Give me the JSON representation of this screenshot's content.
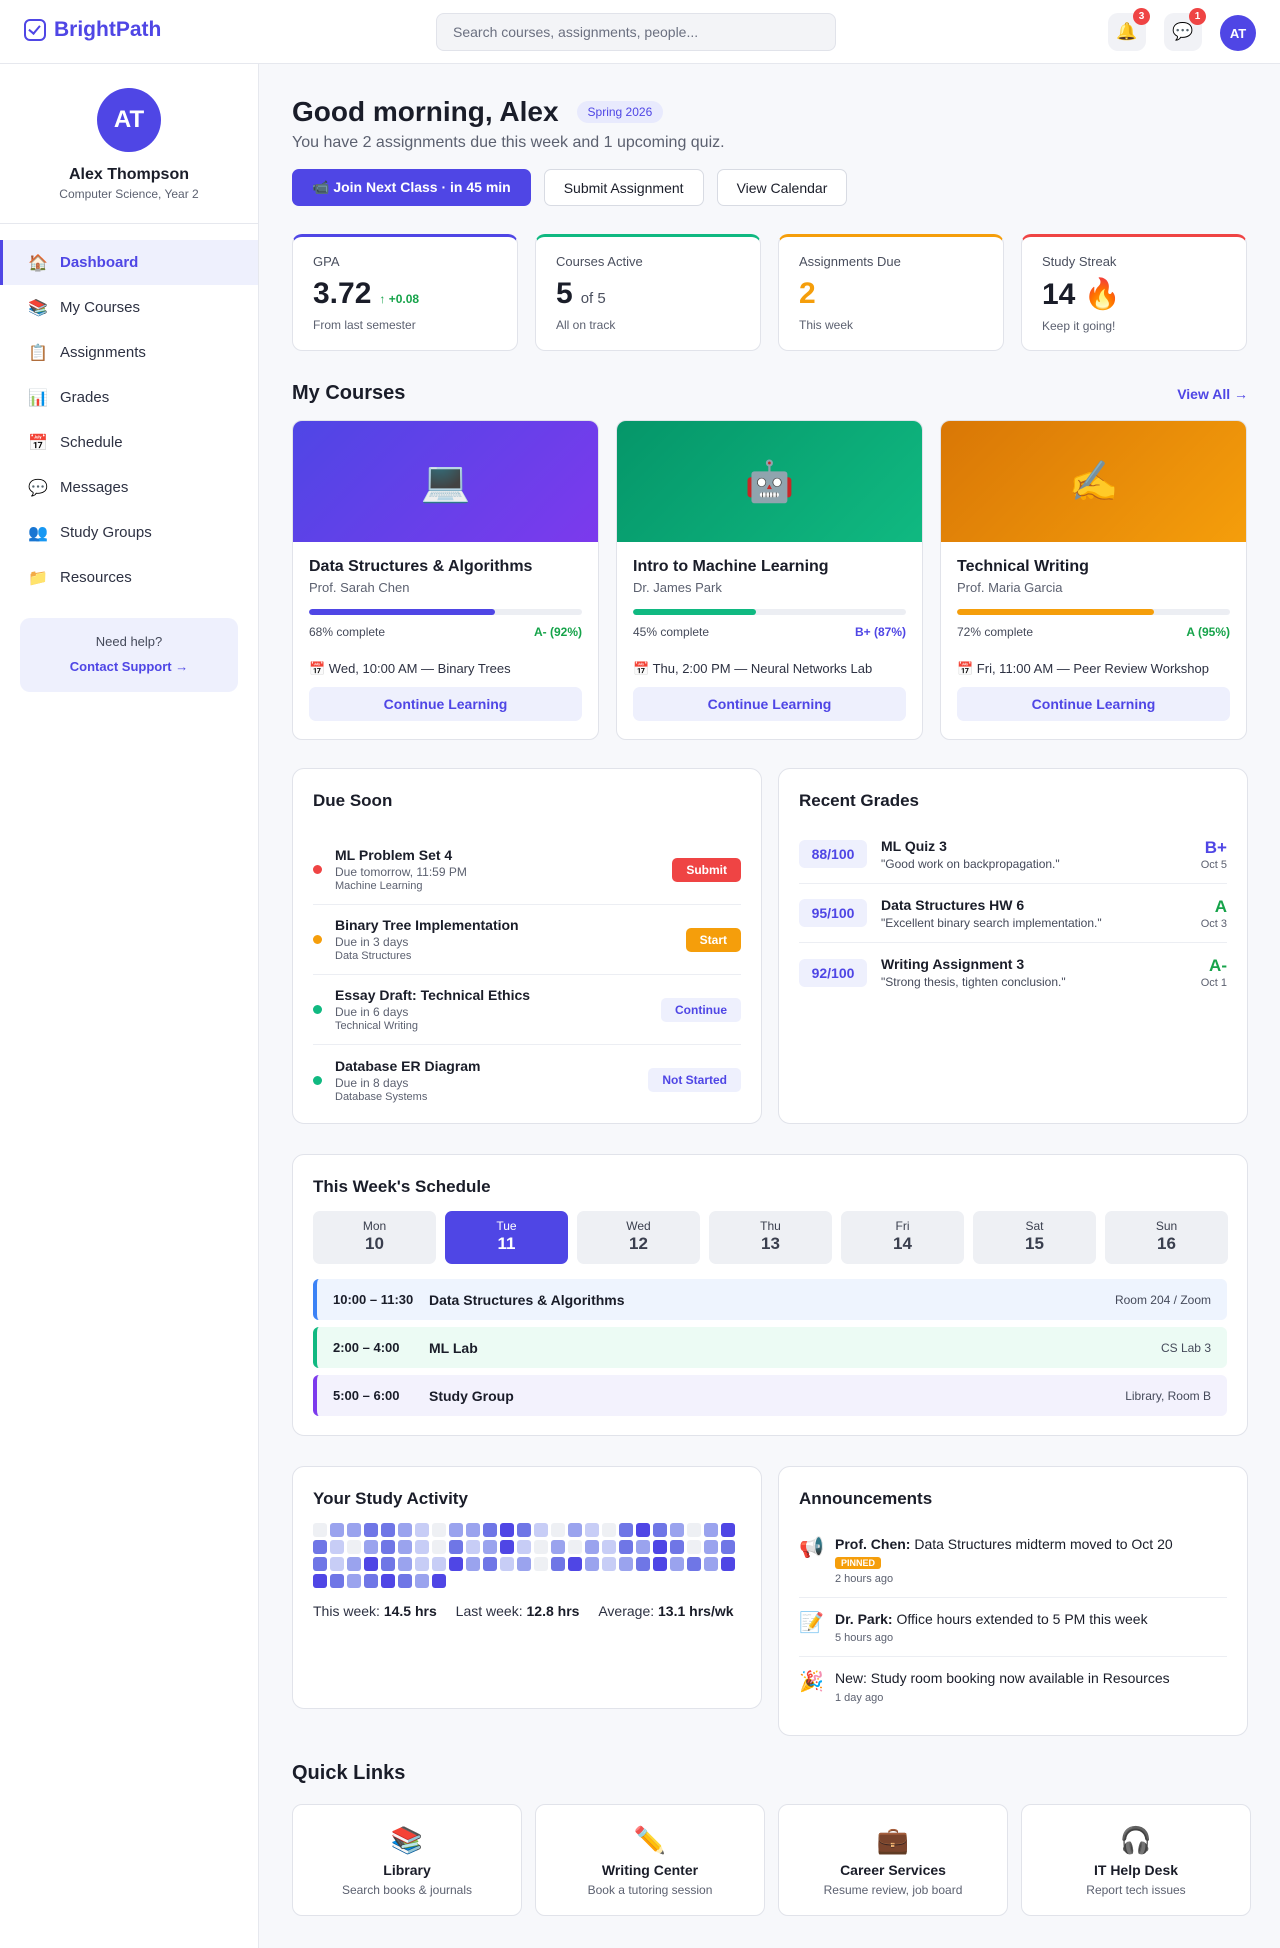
{
  "app": {
    "name": "BrightPath"
  },
  "search": {
    "placeholder": "Search courses, assignments, people..."
  },
  "header": {
    "notifications_count": "3",
    "messages_count": "1",
    "avatar_initials": "AT",
    "bell_icon": "🔔",
    "chat_icon": "💬"
  },
  "profile": {
    "initials": "AT",
    "name": "Alex Thompson",
    "subtitle": "Computer Science, Year 2"
  },
  "nav": [
    {
      "label": "Dashboard",
      "icon": "🏠",
      "active": true
    },
    {
      "label": "My Courses",
      "icon": "📚"
    },
    {
      "label": "Assignments",
      "icon": "📋"
    },
    {
      "label": "Grades",
      "icon": "📊"
    },
    {
      "label": "Schedule",
      "icon": "📅"
    },
    {
      "label": "Messages",
      "icon": "💬"
    },
    {
      "label": "Study Groups",
      "icon": "👥"
    },
    {
      "label": "Resources",
      "icon": "📁"
    }
  ],
  "help": {
    "title": "Need help?",
    "link": "Contact Support →"
  },
  "greeting": {
    "title": "Good morning, Alex",
    "term": "Spring 2026",
    "subtitle": "You have 2 assignments due this week and 1 upcoming quiz."
  },
  "actions": {
    "join": "📹 Join Next Class · in 45 min",
    "submit": "Submit Assignment",
    "calendar": "View Calendar"
  },
  "stats": [
    {
      "label": "GPA",
      "value": "3.72",
      "delta": "↑ +0.08",
      "foot": "From last semester",
      "color": "#4f46e5",
      "value_color": "#1a1d29"
    },
    {
      "label": "Courses Active",
      "value": "5",
      "suffix": "of 5",
      "foot": "All on track",
      "color": "#10b981",
      "value_color": "#1a1d29"
    },
    {
      "label": "Assignments Due",
      "value": "2",
      "foot": "This week",
      "color": "#f59e0b",
      "value_color": "#f59e0b"
    },
    {
      "label": "Study Streak",
      "value": "14 🔥",
      "foot": "Keep it going!",
      "color": "#ef4444",
      "value_color": "#1a1d29"
    }
  ],
  "courses_section": {
    "title": "My Courses",
    "view_all": "View All →"
  },
  "courses": [
    {
      "name": "Data Structures & Algorithms",
      "prof": "Prof. Sarah Chen",
      "progress": 68,
      "progress_label": "68% complete",
      "grade": "A- (92%)",
      "grade_color": "#16a34a",
      "next": "📅 Wed, 10:00 AM — Binary Trees",
      "cta": "Continue Learning",
      "icon": "💻",
      "gradient": "linear-gradient(135deg,#4f46e5,#7c3aed)",
      "bar": "#4f46e5"
    },
    {
      "name": "Intro to Machine Learning",
      "prof": "Dr. James Park",
      "progress": 45,
      "progress_label": "45% complete",
      "grade": "B+ (87%)",
      "grade_color": "#4f46e5",
      "next": "📅 Thu, 2:00 PM — Neural Networks Lab",
      "cta": "Continue Learning",
      "icon": "🤖",
      "gradient": "linear-gradient(135deg,#059669,#10b981)",
      "bar": "#10b981"
    },
    {
      "name": "Technical Writing",
      "prof": "Prof. Maria Garcia",
      "progress": 72,
      "progress_label": "72% complete",
      "grade": "A (95%)",
      "grade_color": "#16a34a",
      "next": "📅 Fri, 11:00 AM — Peer Review Workshop",
      "cta": "Continue Learning",
      "icon": "✍️",
      "gradient": "linear-gradient(135deg,#d97706,#f59e0b)",
      "bar": "#f59e0b"
    }
  ],
  "due_soon": {
    "title": "Due Soon",
    "items": [
      {
        "title": "ML Problem Set 4",
        "due": "Due tomorrow, 11:59 PM",
        "course": "Machine Learning",
        "action": "Submit",
        "dot": "#ef4444",
        "bg": "#ef4444",
        "fg": "#ffffff"
      },
      {
        "title": "Binary Tree Implementation",
        "due": "Due in 3 days",
        "course": "Data Structures",
        "action": "Start",
        "dot": "#f59e0b",
        "bg": "#f59e0b",
        "fg": "#ffffff"
      },
      {
        "title": "Essay Draft: Technical Ethics",
        "due": "Due in 6 days",
        "course": "Technical Writing",
        "action": "Continue",
        "dot": "#10b981",
        "bg": "#eef0fd",
        "fg": "#4f46e5"
      },
      {
        "title": "Database ER Diagram",
        "due": "Due in 8 days",
        "course": "Database Systems",
        "action": "Not Started",
        "dot": "#10b981",
        "bg": "#eef0fd",
        "fg": "#4f46e5"
      }
    ]
  },
  "recent_grades": {
    "title": "Recent Grades",
    "items": [
      {
        "score": "88/100",
        "title": "ML Quiz 3",
        "comment": "\"Good work on backpropagation.\"",
        "letter": "B+",
        "date": "Oct 5",
        "color": "#4f46e5"
      },
      {
        "score": "95/100",
        "title": "Data Structures HW 6",
        "comment": "\"Excellent binary search implementation.\"",
        "letter": "A",
        "date": "Oct 3",
        "color": "#16a34a"
      },
      {
        "score": "92/100",
        "title": "Writing Assignment 3",
        "comment": "\"Strong thesis, tighten conclusion.\"",
        "letter": "A-",
        "date": "Oct 1",
        "color": "#16a34a"
      }
    ]
  },
  "schedule": {
    "title": "This Week's Schedule",
    "days": [
      {
        "name": "Mon",
        "date": "10"
      },
      {
        "name": "Tue",
        "date": "11",
        "active": true
      },
      {
        "name": "Wed",
        "date": "12"
      },
      {
        "name": "Thu",
        "date": "13"
      },
      {
        "name": "Fri",
        "date": "14"
      },
      {
        "name": "Sat",
        "date": "15"
      },
      {
        "name": "Sun",
        "date": "16"
      }
    ],
    "slots": [
      {
        "time": "10:00 – 11:30",
        "name": "Data Structures & Algorithms",
        "location": "Room 204 / Zoom",
        "color": "#3b82f6",
        "bg": "#eef4fe"
      },
      {
        "time": "2:00 – 4:00",
        "name": "ML Lab",
        "location": "CS Lab 3",
        "color": "#10b981",
        "bg": "#ecfbf4"
      },
      {
        "time": "5:00 – 6:00",
        "name": "Study Group",
        "location": "Library, Room B",
        "color": "#7c3aed",
        "bg": "#f3f2fd"
      }
    ]
  },
  "activity": {
    "title": "Your Study Activity",
    "levels": [
      0,
      2,
      2,
      3,
      3,
      2,
      1,
      0,
      2,
      2,
      3,
      4,
      3,
      1,
      0,
      2,
      1,
      0,
      3,
      4,
      3,
      2,
      0,
      2,
      4,
      3,
      1,
      0,
      2,
      3,
      2,
      1,
      0,
      3,
      1,
      2,
      4,
      1,
      0,
      2,
      0,
      2,
      1,
      3,
      2,
      4,
      3,
      0,
      2,
      3,
      3,
      1,
      2,
      4,
      3,
      2,
      1,
      1,
      4,
      2,
      3,
      1,
      2,
      0,
      3,
      4,
      2,
      1,
      2,
      3,
      4,
      2,
      3,
      2,
      4,
      4,
      3,
      2,
      3,
      4,
      3,
      2,
      4
    ],
    "this_week_label": "This week:",
    "this_week": "14.5 hrs",
    "last_week_label": "Last week:",
    "last_week": "12.8 hrs",
    "average_label": "Average:",
    "average": "13.1 hrs/wk"
  },
  "announcements": {
    "title": "Announcements",
    "items": [
      {
        "icon": "📢",
        "author": "Prof. Chen:",
        "text": "Data Structures midterm moved to Oct 20",
        "pinned": "PINNED",
        "ago": "2 hours ago"
      },
      {
        "icon": "📝",
        "author": "Dr. Park:",
        "text": "Office hours extended to 5 PM this week",
        "ago": "5 hours ago"
      },
      {
        "icon": "🎉",
        "author": "",
        "text": "New: Study room booking now available in Resources",
        "ago": "1 day ago"
      }
    ]
  },
  "quick_links": {
    "title": "Quick Links",
    "items": [
      {
        "icon": "📚",
        "name": "Library",
        "sub": "Search books & journals"
      },
      {
        "icon": "✏️",
        "name": "Writing Center",
        "sub": "Book a tutoring session"
      },
      {
        "icon": "💼",
        "name": "Career Services",
        "sub": "Resume review, job board"
      },
      {
        "icon": "🎧",
        "name": "IT Help Desk",
        "sub": "Report tech issues"
      }
    ]
  },
  "colors": {
    "accent": "#4f46e5",
    "heat": [
      "#eef0f4",
      "#c7cdf6",
      "#9aa3ee",
      "#6f76e6",
      "#4f46e5"
    ]
  }
}
